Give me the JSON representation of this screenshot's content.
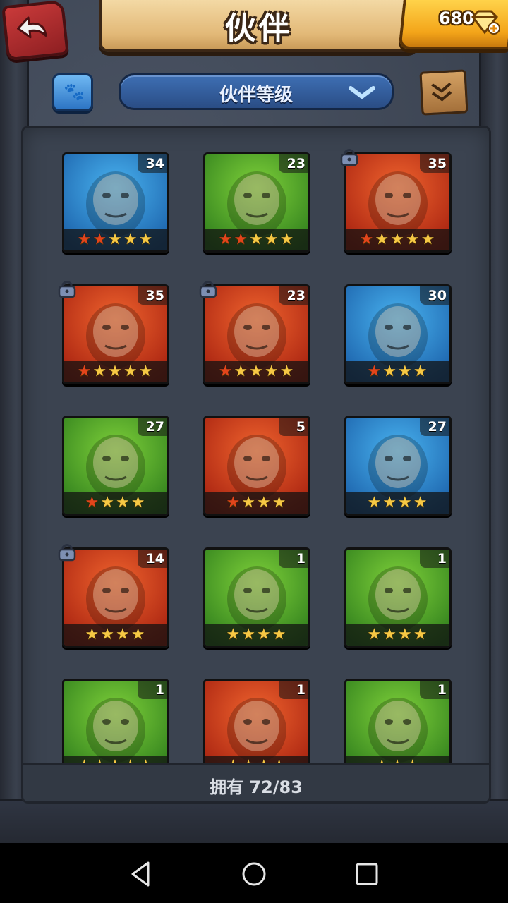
{
  "header": {
    "title": "伙伴",
    "gems": "680"
  },
  "toolbar": {
    "sort_label": "伙伴等级"
  },
  "colors": {
    "red_card": "#d63a1f",
    "green_card": "#3aa12b",
    "blue_card": "#2e8fd6",
    "star_gold": "#f6c844",
    "star_red": "#e2451b"
  },
  "heroes": [
    {
      "level": "34",
      "theme": "blue",
      "stars": 5,
      "red_stars": 2,
      "locked": false,
      "portrait": "long-haired-warrior"
    },
    {
      "level": "23",
      "theme": "green",
      "stars": 5,
      "red_stars": 2,
      "locked": false,
      "portrait": "crocodile"
    },
    {
      "level": "35",
      "theme": "red",
      "stars": 5,
      "red_stars": 1,
      "locked": true,
      "portrait": "panda"
    },
    {
      "level": "35",
      "theme": "red",
      "stars": 5,
      "red_stars": 1,
      "locked": true,
      "portrait": "long-haired-warrior"
    },
    {
      "level": "23",
      "theme": "red",
      "stars": 5,
      "red_stars": 1,
      "locked": true,
      "portrait": "white-haired-woman"
    },
    {
      "level": "30",
      "theme": "blue",
      "stars": 4,
      "red_stars": 1,
      "locked": false,
      "portrait": "blue-beast"
    },
    {
      "level": "27",
      "theme": "green",
      "stars": 4,
      "red_stars": 1,
      "locked": false,
      "portrait": "goblin-hat"
    },
    {
      "level": "5",
      "theme": "red",
      "stars": 4,
      "red_stars": 1,
      "locked": false,
      "portrait": "blonde-woman"
    },
    {
      "level": "27",
      "theme": "blue",
      "stars": 4,
      "red_stars": 0,
      "locked": false,
      "portrait": "dark-haired-woman"
    },
    {
      "level": "14",
      "theme": "red",
      "stars": 4,
      "red_stars": 0,
      "locked": true,
      "portrait": "skull-mask"
    },
    {
      "level": "1",
      "theme": "green",
      "stars": 4,
      "red_stars": 0,
      "locked": false,
      "portrait": "green-goblin"
    },
    {
      "level": "1",
      "theme": "green",
      "stars": 4,
      "red_stars": 0,
      "locked": false,
      "portrait": "skull-mask-blue"
    },
    {
      "level": "1",
      "theme": "green",
      "stars": 5,
      "red_stars": 0,
      "locked": false,
      "portrait": "hooded-ranger"
    },
    {
      "level": "1",
      "theme": "red",
      "stars": 4,
      "red_stars": 0,
      "locked": false,
      "portrait": "red-toad"
    },
    {
      "level": "1",
      "theme": "green",
      "stars": 3,
      "red_stars": 0,
      "locked": false,
      "portrait": "bearded-druid"
    }
  ],
  "footer": {
    "owned_label": "拥有 72/83"
  }
}
